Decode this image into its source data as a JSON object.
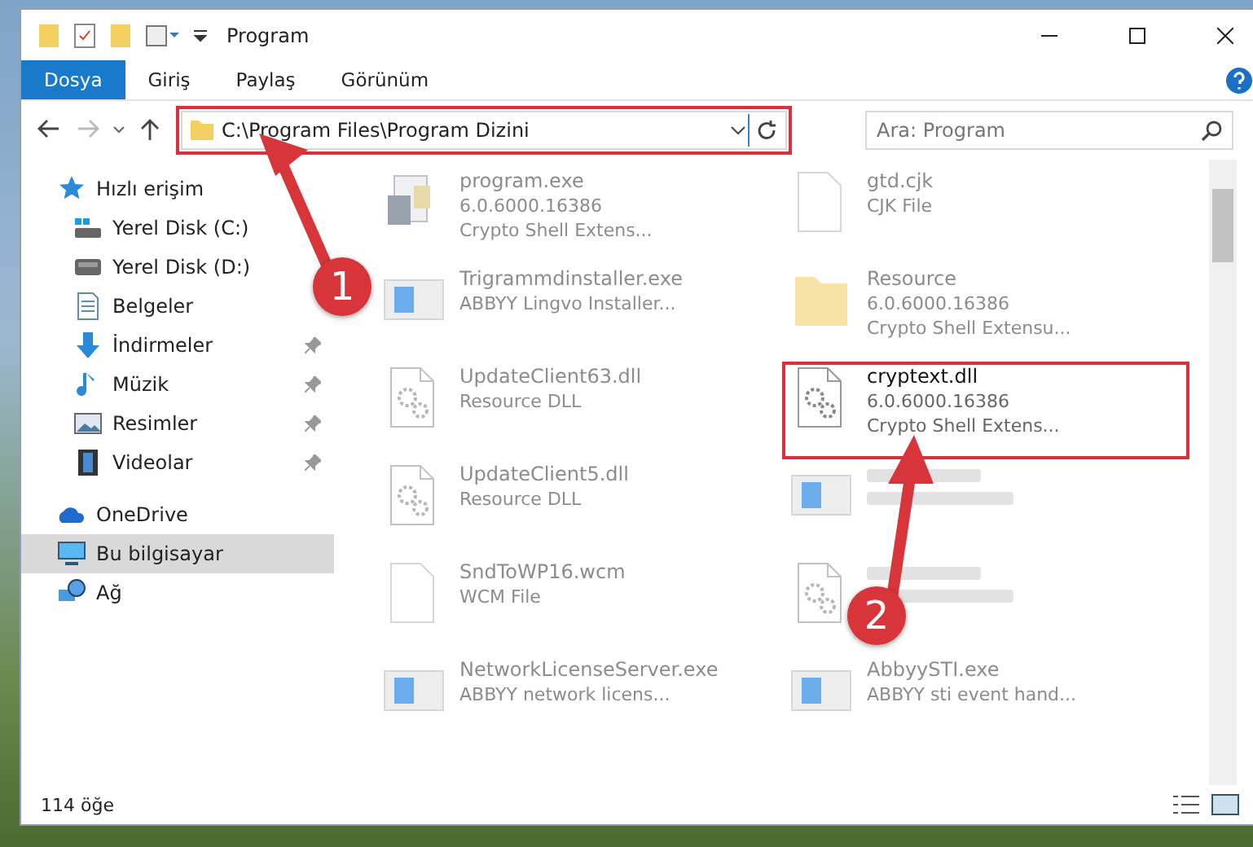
{
  "window": {
    "title": "Program"
  },
  "ribbon_tabs": [
    {
      "label": "Dosya",
      "selected": true
    },
    {
      "label": "Giriş",
      "selected": false
    },
    {
      "label": "Paylaş",
      "selected": false
    },
    {
      "label": "Görünüm",
      "selected": false
    }
  ],
  "address": {
    "path": "C:\\Program Files\\Program Dizini",
    "highlighted": true
  },
  "search": {
    "placeholder": "Ara: Program"
  },
  "sidebar": {
    "items": [
      {
        "label": "Hızlı erişim",
        "pinned": false,
        "selected": false,
        "children": [
          {
            "label": "Yerel Disk (C:)",
            "pinned": false,
            "selected": false
          },
          {
            "label": "Yerel Disk (D:)",
            "pinned": false,
            "selected": false
          },
          {
            "label": "Belgeler",
            "pinned": false,
            "selected": false
          },
          {
            "label": "İndirmeler",
            "pinned": true,
            "selected": false
          },
          {
            "label": "Müzik",
            "pinned": true,
            "selected": false
          },
          {
            "label": "Resimler",
            "pinned": true,
            "selected": false
          },
          {
            "label": "Videolar",
            "pinned": true,
            "selected": false
          }
        ]
      },
      {
        "label": "OneDrive",
        "pinned": false,
        "selected": false
      },
      {
        "label": "Bu bilgisayar",
        "pinned": false,
        "selected": true
      },
      {
        "label": "Ağ",
        "pinned": false,
        "selected": false
      }
    ]
  },
  "files": [
    {
      "kind": "exe",
      "lines": [
        "program.exe",
        "6.0.6000.16386",
        "Crypto Shell Extens..."
      ],
      "blurred": false,
      "dimmed": true,
      "highlighted": false
    },
    {
      "kind": "file",
      "lines": [
        "gtd.cjk",
        "CJK File"
      ],
      "blurred": false,
      "dimmed": true,
      "highlighted": false
    },
    {
      "kind": "app",
      "lines": [
        "Trigrammdinstaller.exe",
        "ABBYY Lingvo Installer..."
      ],
      "blurred": false,
      "dimmed": true,
      "highlighted": false
    },
    {
      "kind": "folder",
      "lines": [
        "Resource",
        "6.0.6000.16386",
        "Crypto Shell Extensu..."
      ],
      "blurred": false,
      "dimmed": true,
      "highlighted": false
    },
    {
      "kind": "dll",
      "lines": [
        "UpdateClient63.dll",
        "Resource DLL"
      ],
      "blurred": false,
      "dimmed": true,
      "highlighted": false
    },
    {
      "kind": "dll",
      "lines": [
        "cryptext.dll",
        "6.0.6000.16386",
        "Crypto Shell Extens..."
      ],
      "blurred": false,
      "dimmed": false,
      "highlighted": true
    },
    {
      "kind": "dll",
      "lines": [
        "UpdateClient5.dll",
        "Resource DLL"
      ],
      "blurred": false,
      "dimmed": true,
      "highlighted": false
    },
    {
      "kind": "app",
      "blurred": true,
      "dimmed": true,
      "highlighted": false
    },
    {
      "kind": "file",
      "lines": [
        "SndToWP16.wcm",
        "WCM File"
      ],
      "blurred": false,
      "dimmed": true,
      "highlighted": false
    },
    {
      "kind": "dll",
      "blurred": true,
      "dimmed": true,
      "highlighted": false
    },
    {
      "kind": "app",
      "lines": [
        "NetworkLicenseServer.exe",
        "ABBYY network licens..."
      ],
      "blurred": false,
      "dimmed": true,
      "highlighted": false
    },
    {
      "kind": "app",
      "lines": [
        "AbbyySTI.exe",
        "ABBYY sti event hand..."
      ],
      "blurred": false,
      "dimmed": true,
      "highlighted": false
    }
  ],
  "status_bar": {
    "count": "114 öğe"
  },
  "annotations": [
    {
      "label": "1"
    },
    {
      "label": "2"
    }
  ]
}
